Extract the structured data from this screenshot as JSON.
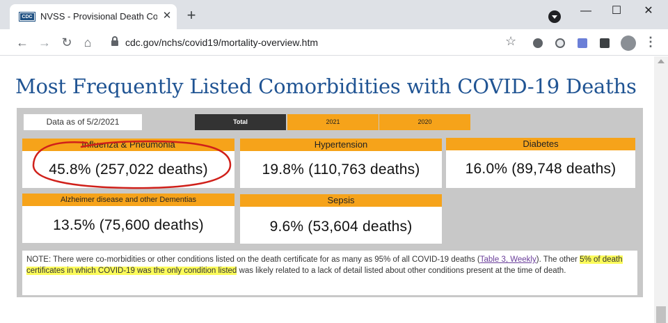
{
  "browser": {
    "tab_title": "NVSS - Provisional Death Counts",
    "favicon_text": "CDC",
    "tab_close": "✕",
    "new_tab": "+",
    "url": "cdc.gov/nchs/covid19/mortality-overview.htm",
    "window_controls": {
      "minimize": "—",
      "maximize": "☐",
      "close": "✕"
    }
  },
  "page": {
    "title": "Most Frequently Listed Comorbidities with COVID-19 Deaths",
    "as_of": "Data as of 5/2/2021",
    "tabs": [
      "Total",
      "2021",
      "2020"
    ],
    "selected_tab": "Total"
  },
  "cards": [
    {
      "label": "Influenza & Pneumonia",
      "value": "45.8% (257,022 deaths)"
    },
    {
      "label": "Hypertension",
      "value": "19.8% (110,763 deaths)"
    },
    {
      "label": "Diabetes",
      "value": "16.0% (89,748 deaths)"
    },
    {
      "label": "Alzheimer disease and other Dementias",
      "value": "13.5% (75,600 deaths)"
    },
    {
      "label": "Sepsis",
      "value": "9.6% (53,604 deaths)"
    }
  ],
  "note": {
    "part1": "NOTE: There were co-morbidities or other conditions listed on the death certificate for as many as 95% of all COVID-19 deaths (",
    "link": "Table 3, Weekly",
    "part2": "). The other ",
    "highlight": "5% of death certificates in which COVID-19 was the only condition listed",
    "part3": " was likely related to a lack of detail listed about other conditions present at the time of death."
  },
  "colors": {
    "accent_orange": "#f6a31a",
    "title_blue": "#205493",
    "annotation_red": "#d0201a",
    "highlight_yellow": "#fbfb5a"
  }
}
